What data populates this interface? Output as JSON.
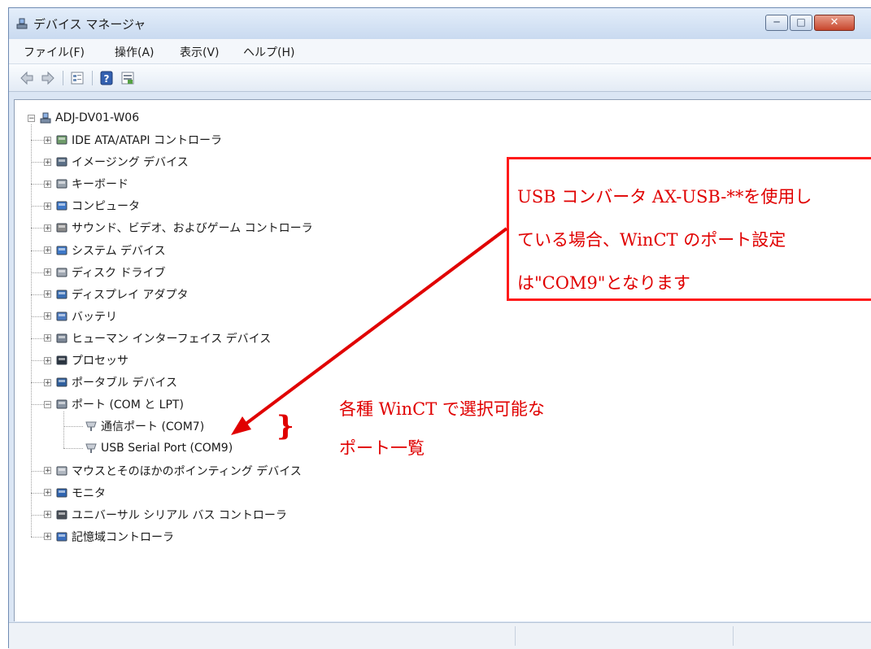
{
  "window": {
    "title": "デバイス マネージャ",
    "controls": {
      "minimize": "─",
      "maximize": "□",
      "close": "✕"
    }
  },
  "menu": [
    "ファイル(F)",
    "操作(A)",
    "表示(V)",
    "ヘルプ(H)"
  ],
  "toolbar_icons": [
    "back-arrow-icon",
    "forward-arrow-icon",
    "properties-icon",
    "help-icon",
    "update-driver-icon"
  ],
  "tree": {
    "root": "ADJ-DV01-W06",
    "categories": [
      {
        "label": "IDE ATA/ATAPI コントローラ",
        "icon": "ide-controller-icon"
      },
      {
        "label": "イメージング デバイス",
        "icon": "camera-icon"
      },
      {
        "label": "キーボード",
        "icon": "keyboard-icon"
      },
      {
        "label": "コンピュータ",
        "icon": "computer-icon"
      },
      {
        "label": "サウンド、ビデオ、およびゲーム コントローラ",
        "icon": "speaker-icon"
      },
      {
        "label": "システム デバイス",
        "icon": "system-device-icon"
      },
      {
        "label": "ディスク ドライブ",
        "icon": "disk-drive-icon"
      },
      {
        "label": "ディスプレイ アダプタ",
        "icon": "display-adapter-icon"
      },
      {
        "label": "バッテリ",
        "icon": "battery-icon"
      },
      {
        "label": "ヒューマン インターフェイス デバイス",
        "icon": "hid-icon"
      },
      {
        "label": "プロセッサ",
        "icon": "processor-icon"
      },
      {
        "label": "ポータブル デバイス",
        "icon": "portable-device-icon"
      },
      {
        "label": "ポート (COM と LPT)",
        "icon": "port-icon",
        "expanded": true,
        "children": [
          "通信ポート (COM7)",
          "USB Serial Port (COM9)"
        ]
      },
      {
        "label": "マウスとそのほかのポインティング デバイス",
        "icon": "mouse-icon"
      },
      {
        "label": "モニタ",
        "icon": "monitor-icon"
      },
      {
        "label": "ユニバーサル シリアル バス コントローラ",
        "icon": "usb-icon"
      },
      {
        "label": "記憶域コントローラ",
        "icon": "storage-controller-icon"
      }
    ]
  },
  "annotations": {
    "callout_lines": [
      "USB コンバータ AX-USB-**を使用し",
      "ている場合、WinCT のポート設定",
      "は\"COM9\"となります"
    ],
    "port_list_note": [
      "各種 WinCT で選択可能な",
      "ポート一覧"
    ],
    "brace": "}",
    "accent_color": "#e00000"
  }
}
